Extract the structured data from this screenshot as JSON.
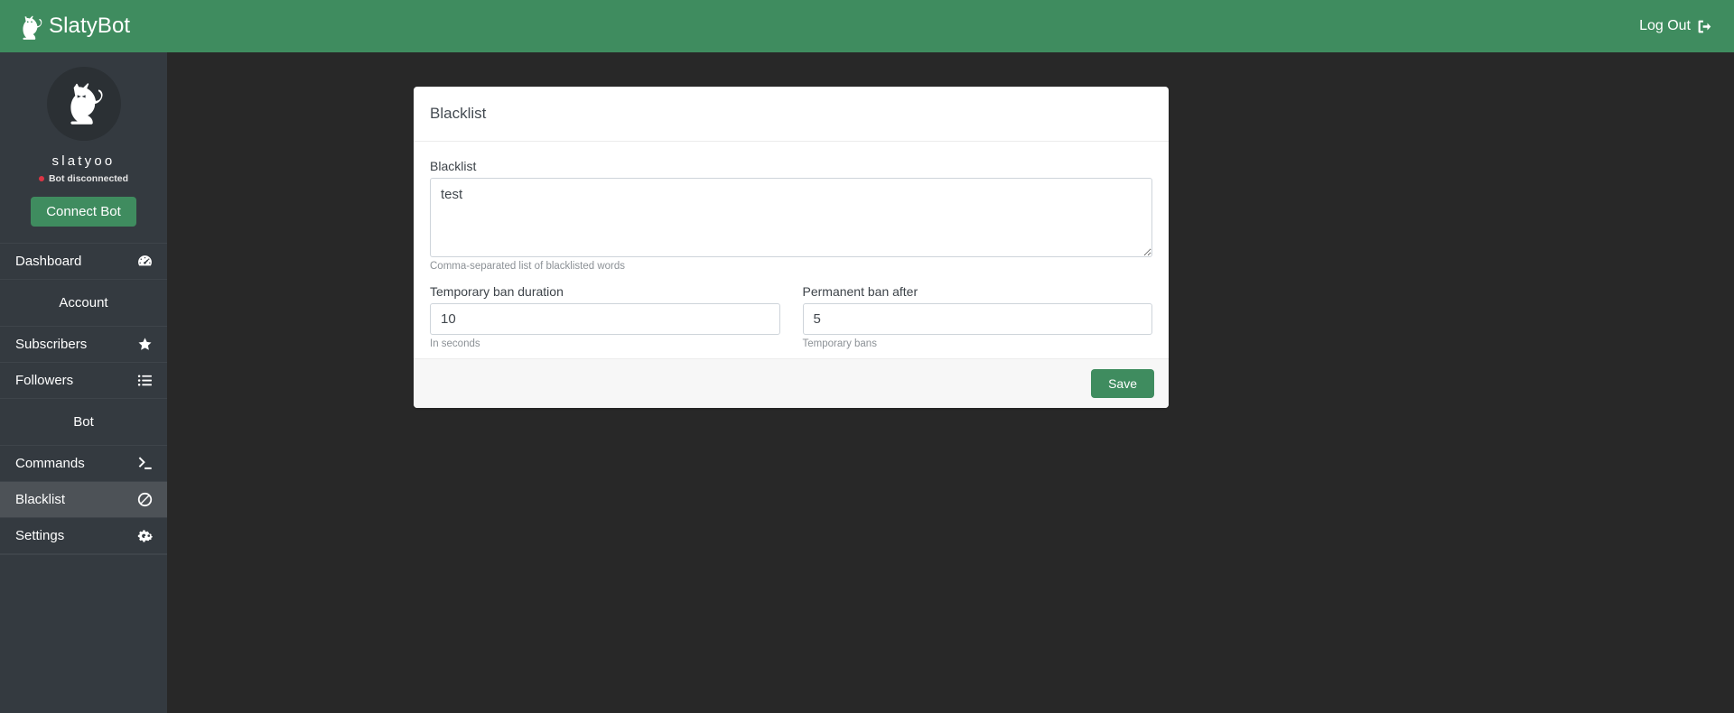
{
  "navbar": {
    "brand": "SlatyBot",
    "brand_logo_icon": "cat-logo-icon",
    "logout_label": "Log Out",
    "logout_icon": "sign-out-icon",
    "background_color": "#3f8c5f"
  },
  "sidebar": {
    "avatar_icon": "cat-avatar-icon",
    "username": "slatyoo",
    "bot_status": "Bot disconnected",
    "status_color": "#dc3545",
    "connect_button": "Connect Bot",
    "background_color": "#343a40",
    "active_item_color": "#4d5257",
    "items": [
      {
        "label": "Dashboard",
        "icon": "tachometer-icon",
        "active": false
      },
      {
        "label": "Subscribers",
        "icon": "star-icon",
        "active": false
      },
      {
        "label": "Followers",
        "icon": "list-icon",
        "active": false
      },
      {
        "label": "Commands",
        "icon": "terminal-icon",
        "active": false
      },
      {
        "label": "Blacklist",
        "icon": "ban-icon",
        "active": true
      },
      {
        "label": "Settings",
        "icon": "cogs-icon",
        "active": false
      }
    ],
    "sections": [
      {
        "label": "Account"
      },
      {
        "label": "Bot"
      }
    ]
  },
  "card": {
    "title": "Blacklist",
    "blacklist": {
      "label": "Blacklist",
      "value": "test",
      "placeholder": "",
      "help": "Comma-separated list of blacklisted words"
    },
    "temp_ban": {
      "label": "Temporary ban duration",
      "value": "10",
      "placeholder": "",
      "help": "In seconds"
    },
    "perm_ban": {
      "label": "Permanent ban after",
      "value": "5",
      "placeholder": "",
      "help": "Temporary bans"
    },
    "save_label": "Save",
    "accent_color": "#3f8c5f"
  }
}
